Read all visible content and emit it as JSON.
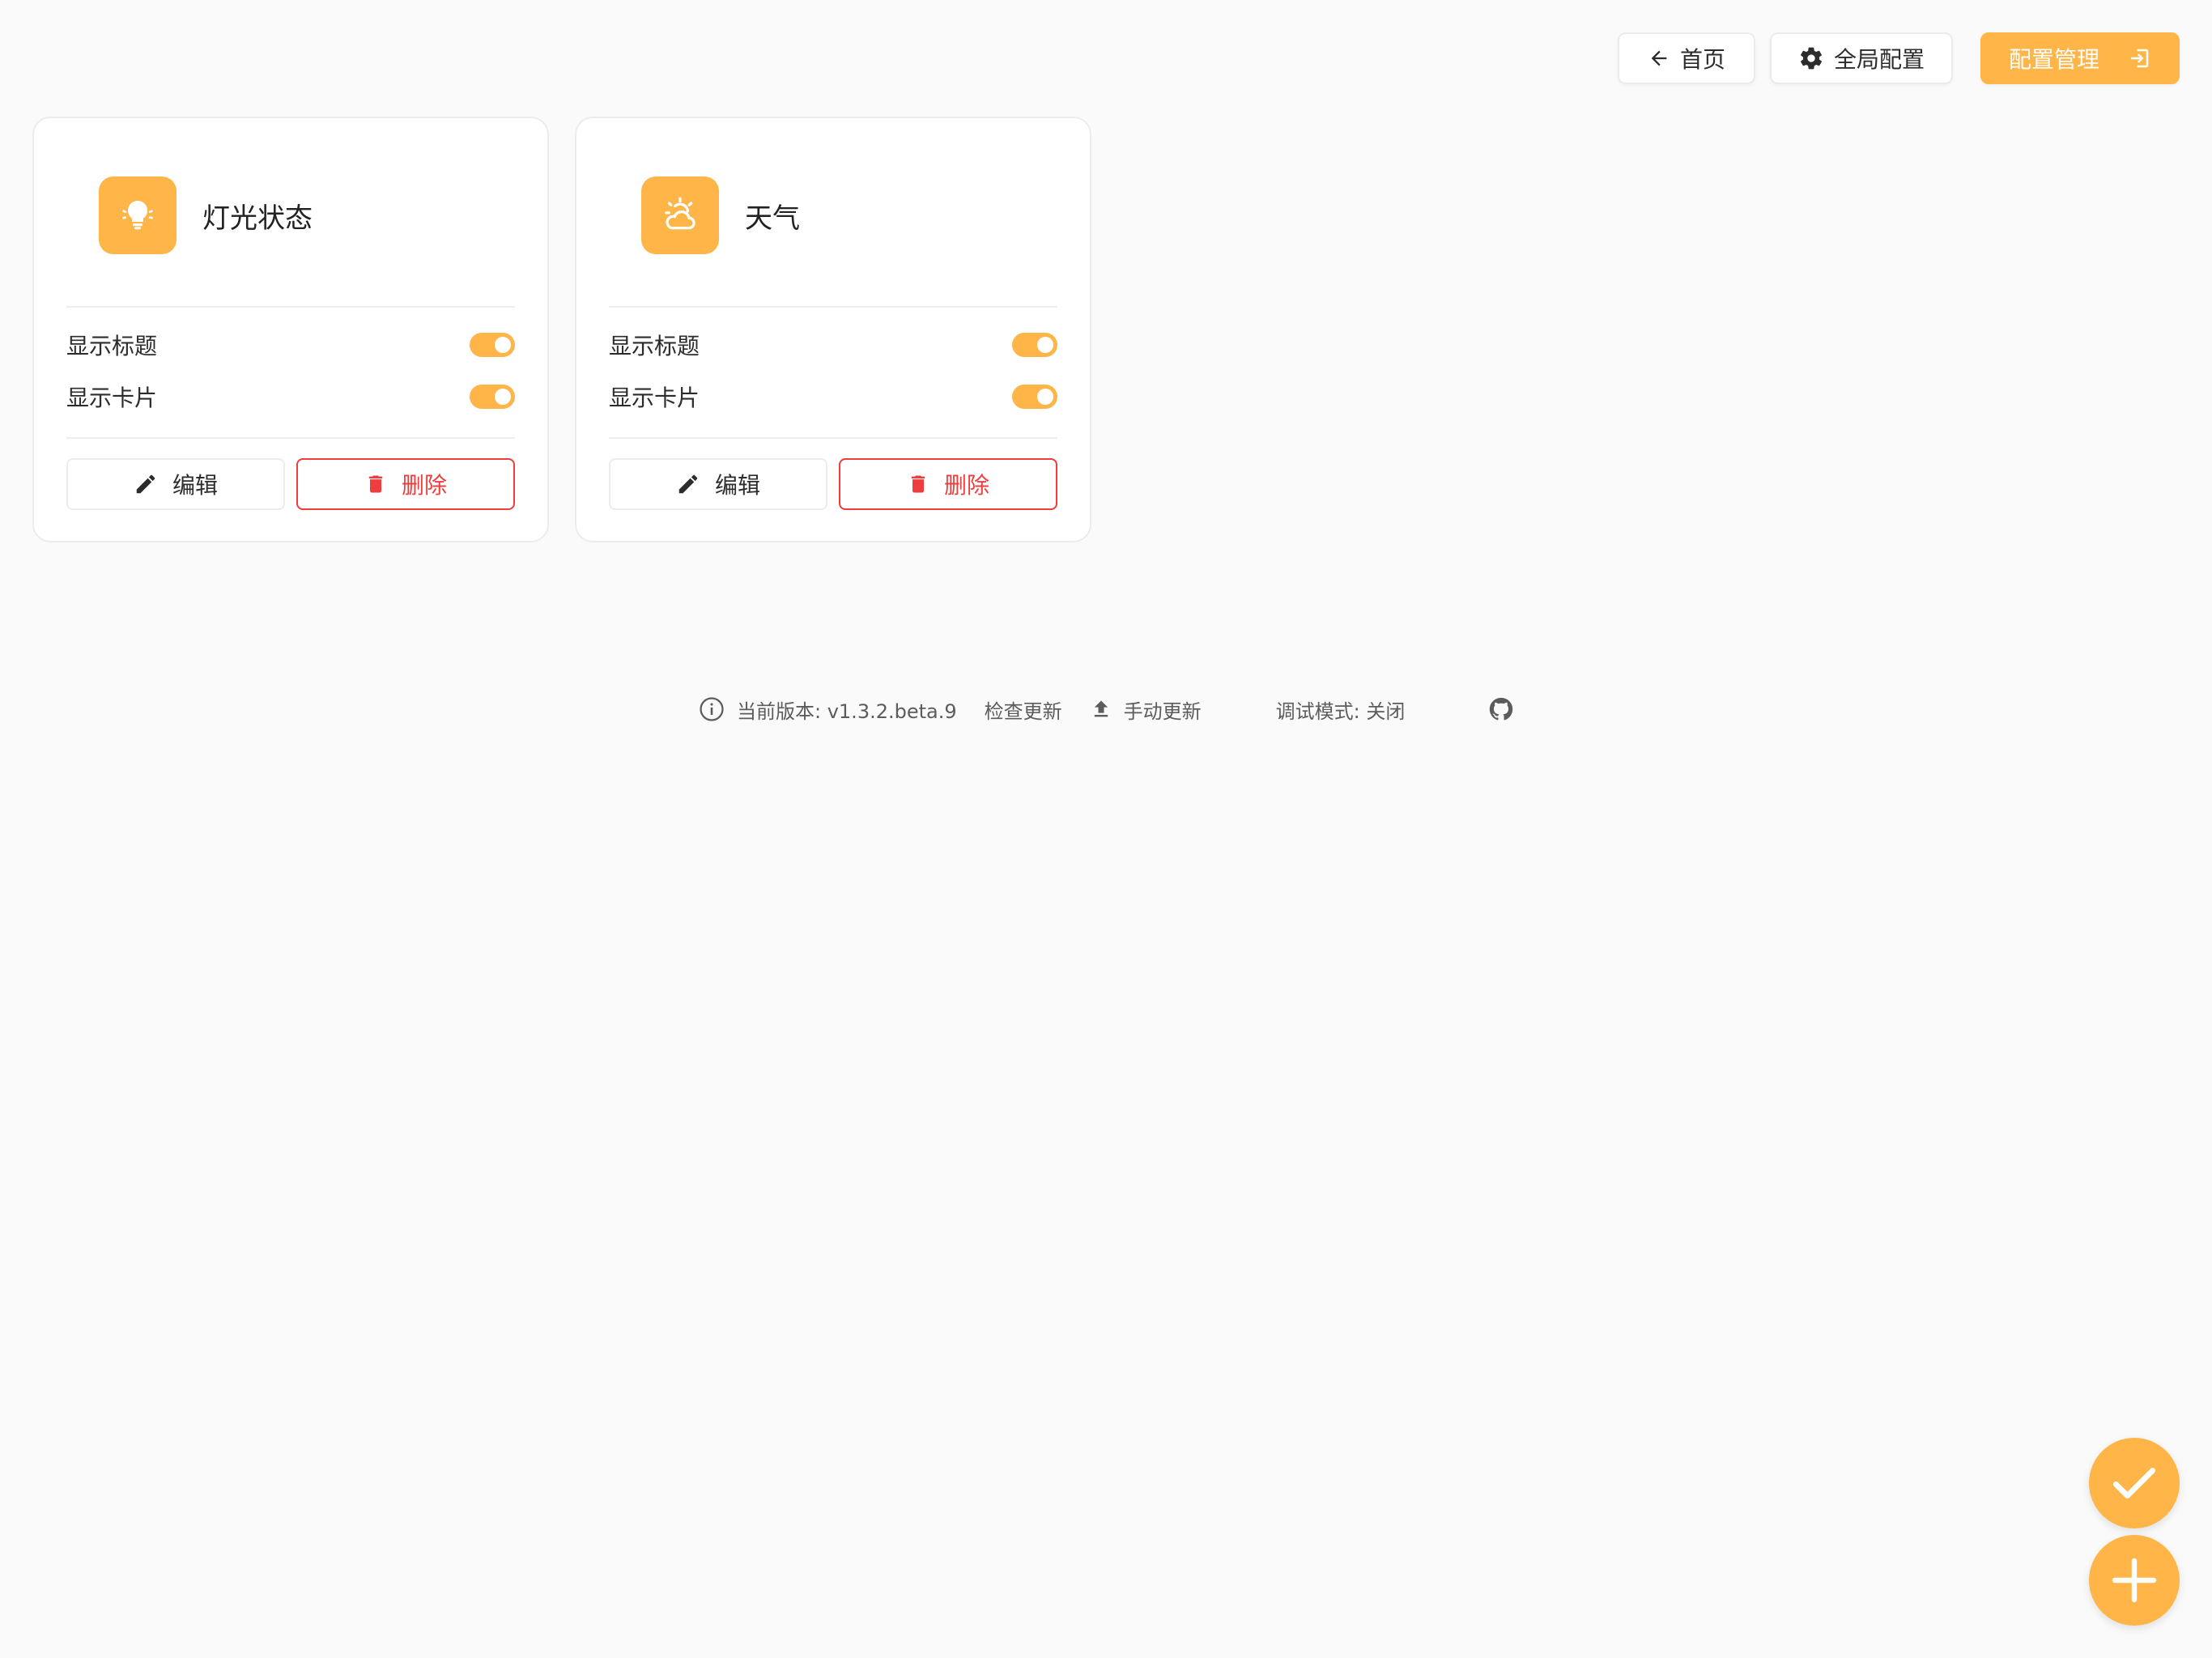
{
  "topbar": {
    "home_label": "首页",
    "global_config_label": "全局配置",
    "config_manage_label": "配置管理"
  },
  "cards": [
    {
      "title": "灯光状态",
      "icon": "lightbulb-icon",
      "show_title_label": "显示标题",
      "show_title_on": true,
      "show_card_label": "显示卡片",
      "show_card_on": true,
      "edit_label": "编辑",
      "delete_label": "删除"
    },
    {
      "title": "天气",
      "icon": "weather-icon",
      "show_title_label": "显示标题",
      "show_title_on": true,
      "show_card_label": "显示卡片",
      "show_card_on": true,
      "edit_label": "编辑",
      "delete_label": "删除"
    }
  ],
  "footer": {
    "version_text": "当前版本: v1.3.2.beta.9",
    "check_update_label": "检查更新",
    "manual_update_label": "手动更新",
    "debug_mode_text": "调试模式: 关闭"
  },
  "colors": {
    "accent": "#ffb547",
    "danger": "#ef3d3d",
    "background": "#fafafa"
  }
}
